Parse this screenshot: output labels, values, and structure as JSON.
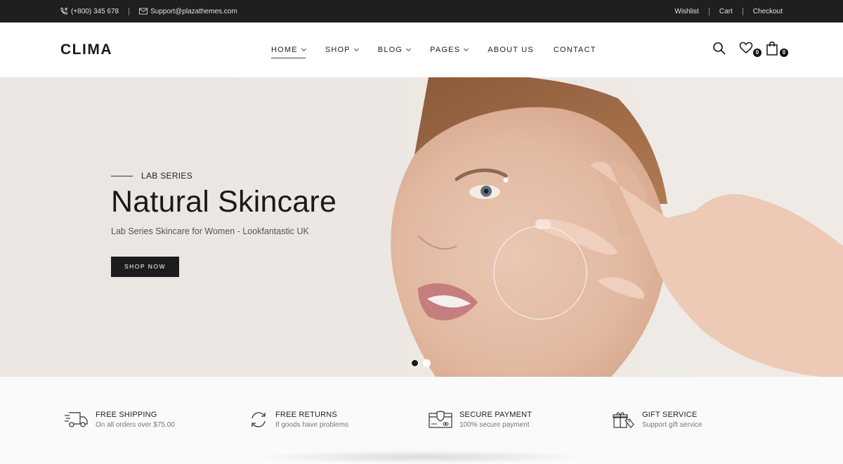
{
  "topbar": {
    "phone": "(+800) 345 678",
    "email": "Support@plazathemes.com",
    "links": [
      "Wishlist",
      "Cart",
      "Checkout"
    ]
  },
  "header": {
    "logo": "CLIMA",
    "nav": [
      {
        "label": "HOME",
        "has_dropdown": true,
        "active": true
      },
      {
        "label": "SHOP",
        "has_dropdown": true
      },
      {
        "label": "BLOG",
        "has_dropdown": true
      },
      {
        "label": "PAGES",
        "has_dropdown": true
      },
      {
        "label": "ABOUT US",
        "has_dropdown": false
      },
      {
        "label": "CONTACT",
        "has_dropdown": false
      }
    ],
    "wishlist_count": "0",
    "cart_count": "0"
  },
  "hero": {
    "eyebrow": "LAB SERIES",
    "title": "Natural Skincare",
    "subtitle": "Lab Series Skincare for Women - Lookfantastic UK",
    "button": "SHOP NOW",
    "slides": 2,
    "active_slide": 1
  },
  "features": [
    {
      "icon": "truck-icon",
      "title": "FREE SHIPPING",
      "subtitle": "On all orders over $75.00"
    },
    {
      "icon": "refresh-icon",
      "title": "FREE RETURNS",
      "subtitle": "If goods have problems"
    },
    {
      "icon": "secure-card-icon",
      "title": "SECURE PAYMENT",
      "subtitle": "100% secure payment"
    },
    {
      "icon": "gift-icon",
      "title": "GIFT SERVICE",
      "subtitle": "Support gift service"
    }
  ]
}
